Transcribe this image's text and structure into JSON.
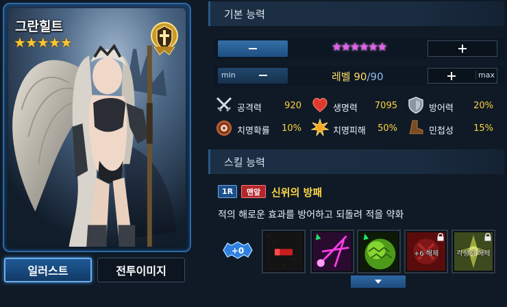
{
  "character": {
    "name": "그란힐트",
    "stars": "★★★★★",
    "tabs": {
      "illustration": "일러스트",
      "battle_image": "전투이미지"
    }
  },
  "basic": {
    "header": "기본 능력",
    "evolution_stars": "★★★★★★",
    "level_label": "레벨 ",
    "level_current": "90",
    "level_max": "/90",
    "min_label": "min",
    "max_label": "max",
    "stats": [
      {
        "name": "공격력",
        "value": "920",
        "icon": "crossed-swords-icon"
      },
      {
        "name": "생명력",
        "value": "7095",
        "icon": "heart-icon"
      },
      {
        "name": "방어력",
        "value": "20%",
        "icon": "shield-icon"
      },
      {
        "name": "치명확률",
        "value": "10%",
        "icon": "target-icon"
      },
      {
        "name": "치명피해",
        "value": "50%",
        "icon": "burst-icon"
      },
      {
        "name": "민첩성",
        "value": "15%",
        "icon": "boot-icon"
      }
    ]
  },
  "skill": {
    "header": "스킬 능력",
    "tag_round": "1R",
    "tag_position": "맨앞",
    "name": "신위의 방패",
    "description": "적의 해로운 효과를 방어하고 되돌려 적을 약화",
    "level_badge": "+0",
    "slots": [
      {
        "icon": "red-bar-icon",
        "caption": ""
      },
      {
        "icon": "magenta-strike-icon",
        "caption": ""
      },
      {
        "icon": "green-orb-icon",
        "caption": ""
      },
      {
        "icon": "locked-slot-icon",
        "caption": "+6 해제"
      },
      {
        "icon": "locked-slot-icon",
        "caption": "각성시 해제"
      }
    ]
  }
}
